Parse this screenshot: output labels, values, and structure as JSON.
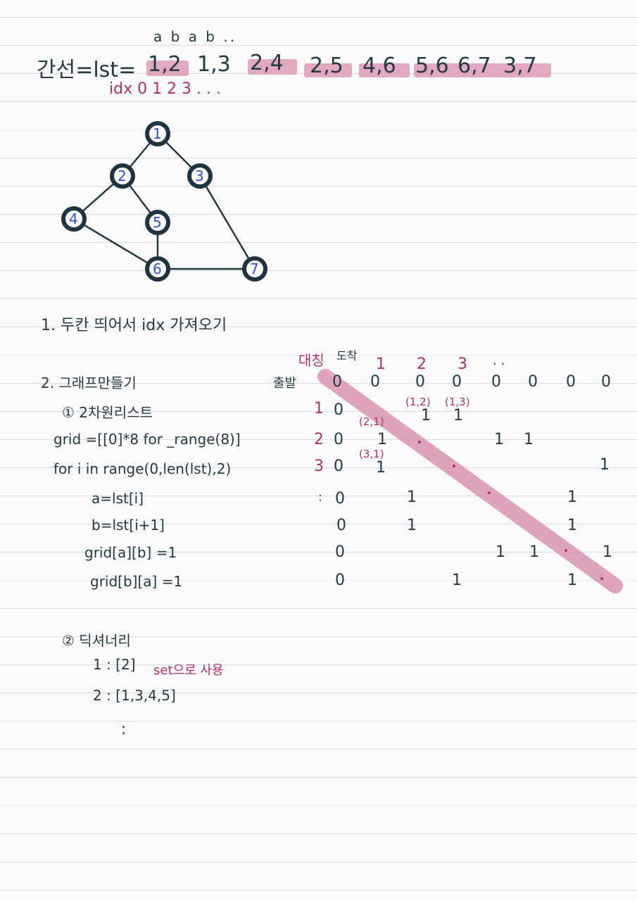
{
  "header": {
    "ab_letters": "a  b   a b ..",
    "label": "간선=lst=",
    "pairs": [
      "1,2",
      "1,3",
      "2,4",
      "2,5",
      "4,6",
      "5,6",
      "6,7",
      "3,7"
    ],
    "idx_line": "idx  0   1    2  3     . . ."
  },
  "graph": {
    "nodes": [
      "1",
      "2",
      "3",
      "4",
      "5",
      "6",
      "7"
    ]
  },
  "step1": {
    "text": "1. 두칸 띄어서 idx 가져오기"
  },
  "step2": {
    "title": "2. 그래프만들기",
    "sub1": "① 2차원리스트",
    "code": [
      "grid =[[0]*8 for _range(8)]",
      "for i in range(0,len(lst),2)",
      "a=lst[i]",
      "b=lst[i+1]",
      "grid[a][b] =1",
      "grid[b][a] =1"
    ]
  },
  "matrix": {
    "symmetry": "대칭",
    "arrival": "도착",
    "departure": "출발",
    "col_labels": [
      "1",
      "2",
      "3",
      ". ."
    ],
    "row_labels": [
      "1",
      "2",
      "3",
      ":"
    ],
    "zero": "0",
    "one": "1",
    "annotations": [
      "(1,2)",
      "(1,3)",
      "(2,1)",
      "(3,1)"
    ]
  },
  "step3": {
    "title": "② 딕셔너리",
    "line1": "1 : [2]",
    "note": "set으로 사용",
    "line2": "2 : [1,3,4,5]",
    "dots": ":"
  }
}
